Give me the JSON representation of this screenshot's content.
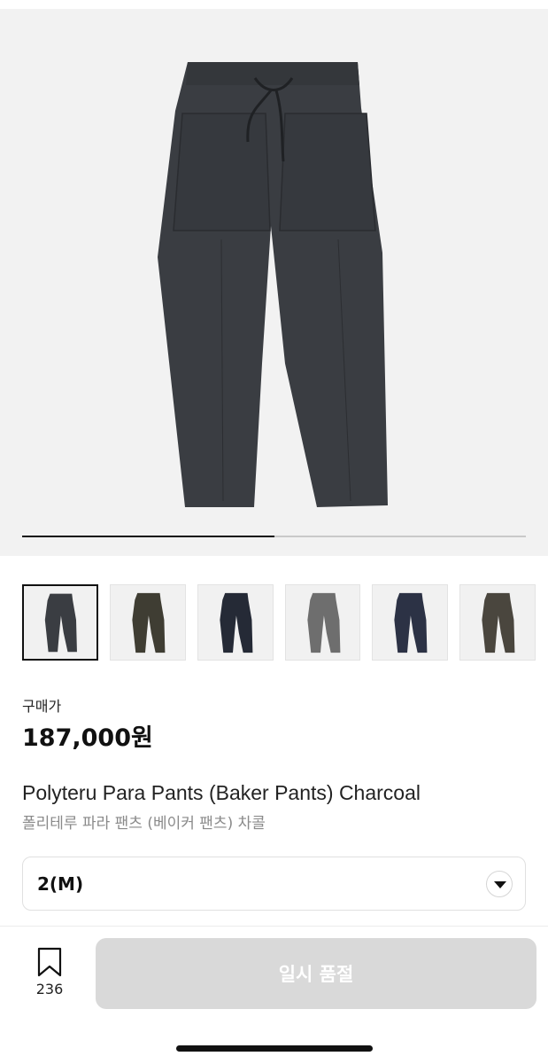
{
  "gallery": {
    "image_description": "product-photo-charcoal-pants",
    "progress_fraction": 0.5,
    "thumbnails": [
      {
        "name": "thumb-charcoal",
        "color": "#3a3d42",
        "selected": true
      },
      {
        "name": "thumb-olive",
        "color": "#3f3d33",
        "selected": false
      },
      {
        "name": "thumb-navy-dark",
        "color": "#252a36",
        "selected": false
      },
      {
        "name": "thumb-grey",
        "color": "#6e6e6e",
        "selected": false
      },
      {
        "name": "thumb-navy",
        "color": "#2c3245",
        "selected": false
      },
      {
        "name": "thumb-brown",
        "color": "#4a463e",
        "selected": false
      }
    ]
  },
  "price": {
    "label": "구매가",
    "value": "187,000원"
  },
  "product": {
    "name_en": "Polyteru Para Pants (Baker Pants) Charcoal",
    "name_ko": "폴리테루 파라 팬츠 (베이커 팬츠) 차콜"
  },
  "size_select": {
    "value": "2(M)",
    "icon": "chevron-down-icon"
  },
  "footer": {
    "bookmark_icon": "bookmark-icon",
    "bookmark_count": "236",
    "buy_label": "일시 품절"
  },
  "colors": {
    "button_disabled": "#d9d9d9",
    "pants_main": "#3a3d42"
  }
}
